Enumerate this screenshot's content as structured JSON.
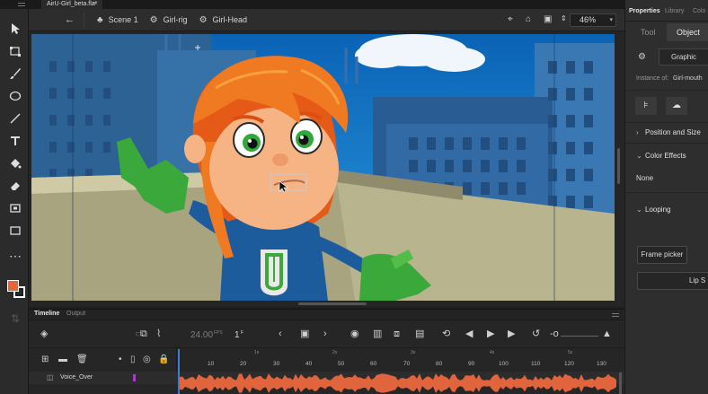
{
  "document": {
    "tab_title": "AirU-Girl_beta.fla*",
    "close_glyph": "×"
  },
  "editbar": {
    "back": "←",
    "crumbs": [
      {
        "icon": "scene-icon",
        "label": "Scene 1"
      },
      {
        "icon": "symbol-icon",
        "label": "Girl-rig"
      },
      {
        "icon": "symbol-icon",
        "label": "Girl-Head"
      }
    ],
    "zoom": "46%"
  },
  "toolbar": {
    "tools": [
      "selection-tool",
      "free-transform-tool",
      "brush-tool",
      "oval-tool",
      "line-tool",
      "text-tool",
      "paint-bucket-tool",
      "eraser-tool",
      "camera-tool",
      "rectangle-tool",
      "more-tools"
    ],
    "fill_color": "#e8643a",
    "stroke_color": "#ffffff"
  },
  "timeline": {
    "tabs": {
      "timeline": "Timeline",
      "output": "Output"
    },
    "fps": "24.00",
    "fps_unit": "FPS",
    "frame": "1",
    "frame_unit": "F",
    "seconds": [
      "1s",
      "2s",
      "3s",
      "4s",
      "5s"
    ],
    "frame_numbers": [
      "10",
      "20",
      "30",
      "40",
      "50",
      "60",
      "70",
      "80",
      "90",
      "100",
      "110",
      "120",
      "130"
    ],
    "layer": {
      "name": "Voice_Over",
      "color": "#a040c0"
    },
    "waveform_color": "#e0643c"
  },
  "properties": {
    "tabs": {
      "properties": "Properties",
      "library": "Library",
      "color": "Colo"
    },
    "tool_tab": "Tool",
    "object_tab": "Object",
    "symbol_type": "Graphic",
    "instance_label": "Instance of:",
    "instance_value": "Girl-mouth",
    "sections": {
      "position": "Position and Size",
      "color_effects": "Color Effects",
      "looping": "Looping"
    },
    "color_effect_value": "None",
    "frame_picker": "Frame picker",
    "lip_sync": "Lip S"
  }
}
